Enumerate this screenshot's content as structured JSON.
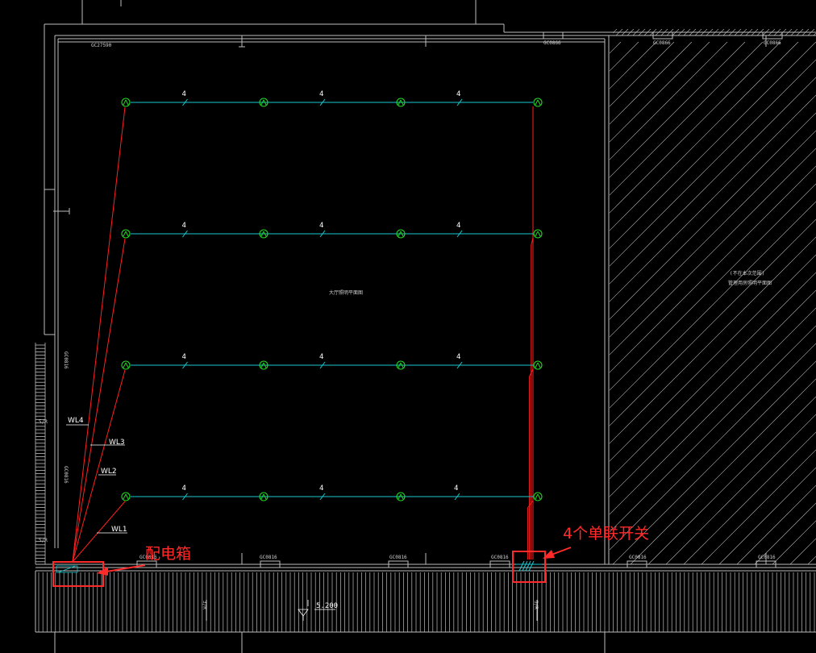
{
  "colors": {
    "wall": "#bdbdbd",
    "fixture": "#23d623",
    "branch_wire": "#19c7d0",
    "feeder_wire": "#ff2020",
    "annotation": "#ff2a2a",
    "text": "#ffffff"
  },
  "icons": {
    "fixture": "lamp-symbol-icon",
    "wire_tick": "conductor-tick-icon",
    "panel": "distribution-box-icon",
    "switch": "switch-bank-icon"
  },
  "labels": {
    "top_window_left": "GC27590",
    "top_window_mid": "GC0866",
    "top_window_r1": "GC0866",
    "top_window_r2": "GC0866",
    "room_note": "大厅照明平面图",
    "right_note_1": "(不在本次范围)",
    "right_note_2": "管理用房照明平面图",
    "left_window_1": "GC0816",
    "left_window_2": "GC0816",
    "stair_1": "5/R",
    "stair_2": "5/R",
    "bottom_window_1": "GC0816",
    "bottom_window_2": "GC0816",
    "bottom_window_3": "GC0816",
    "bottom_window_4": "GC0816",
    "bottom_window_5": "GC0816",
    "bottom_window_6": "GC0816",
    "bottom_dim_1": "3/R",
    "bottom_dim_2": "3/R",
    "level": "5.200",
    "tick": "4"
  },
  "circuits": [
    "WL4",
    "WL3",
    "WL2",
    "WL1"
  ],
  "annotations": {
    "panel": "配电箱",
    "switches": "4个单联开关"
  }
}
